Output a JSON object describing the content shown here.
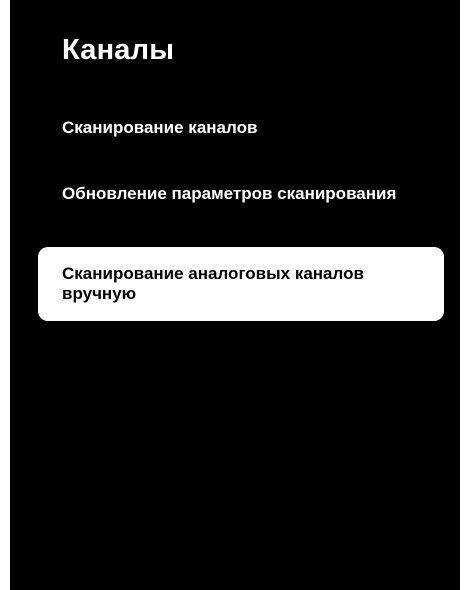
{
  "screen": {
    "title": "Каналы",
    "menu": {
      "items": [
        {
          "label": "Сканирование каналов",
          "selected": false
        },
        {
          "label": "Обновление параметров сканирования",
          "selected": false
        },
        {
          "label": "Сканирование аналоговых каналов вручную",
          "selected": true
        }
      ]
    },
    "colors": {
      "background": "#000000",
      "text": "#ffffff",
      "highlight_background": "#ffffff",
      "highlight_text": "#000000"
    }
  }
}
